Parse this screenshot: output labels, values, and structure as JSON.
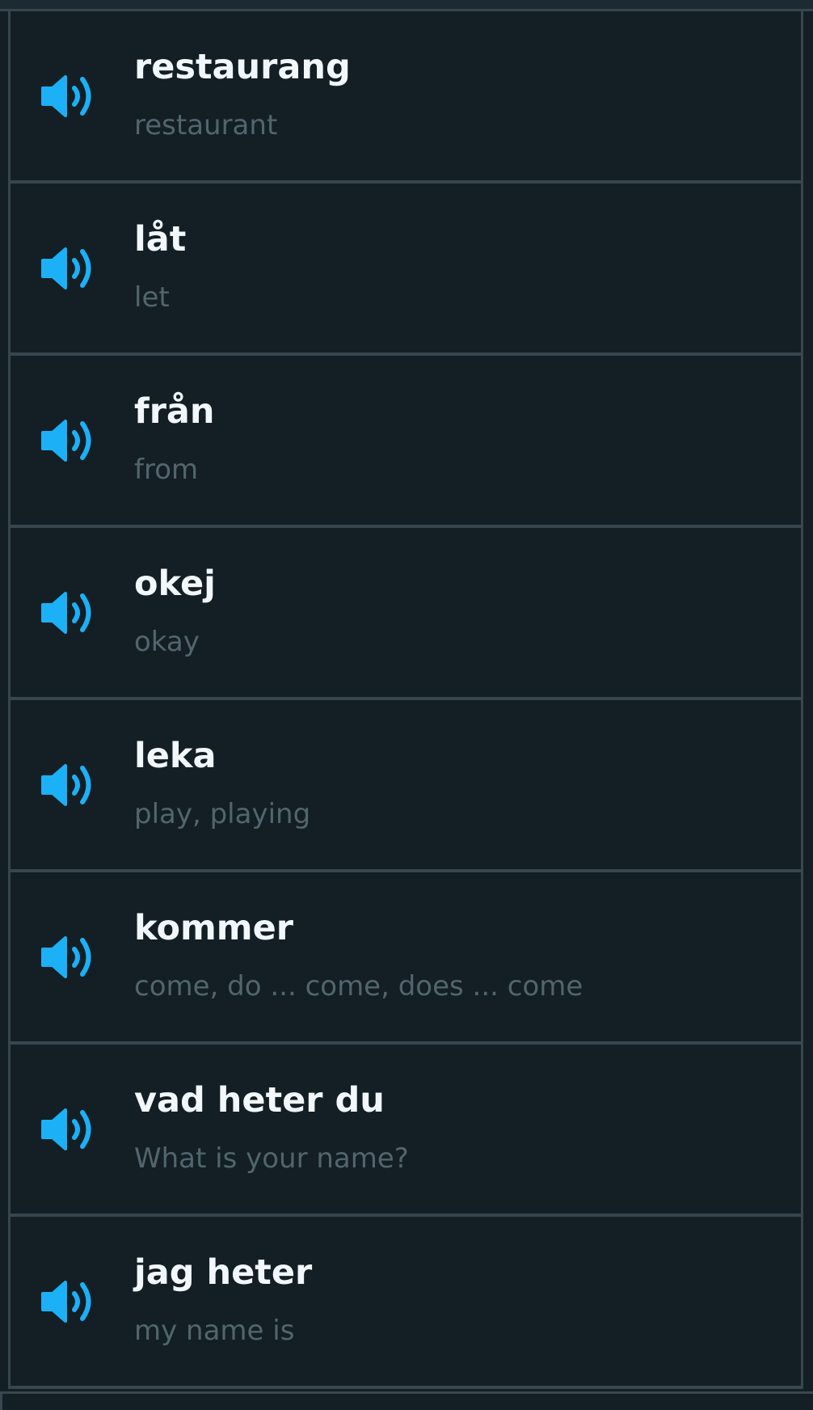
{
  "colors": {
    "background": "#131f24",
    "divider": "#37464f",
    "word": "#f1f7fb",
    "translation": "#52656d",
    "accent": "#1cb0f6"
  },
  "vocab": [
    {
      "word": "restaurang",
      "translation": "restaurant",
      "icon": "speaker-icon"
    },
    {
      "word": "låt",
      "translation": "let",
      "icon": "speaker-icon"
    },
    {
      "word": "från",
      "translation": "from",
      "icon": "speaker-icon"
    },
    {
      "word": "okej",
      "translation": "okay",
      "icon": "speaker-icon"
    },
    {
      "word": "leka",
      "translation": "play, playing",
      "icon": "speaker-icon"
    },
    {
      "word": "kommer",
      "translation": "come, do ... come, does ... come",
      "icon": "speaker-icon"
    },
    {
      "word": "vad heter du",
      "translation": "What is your name?",
      "icon": "speaker-icon"
    },
    {
      "word": "jag heter",
      "translation": "my name is",
      "icon": "speaker-icon"
    }
  ]
}
